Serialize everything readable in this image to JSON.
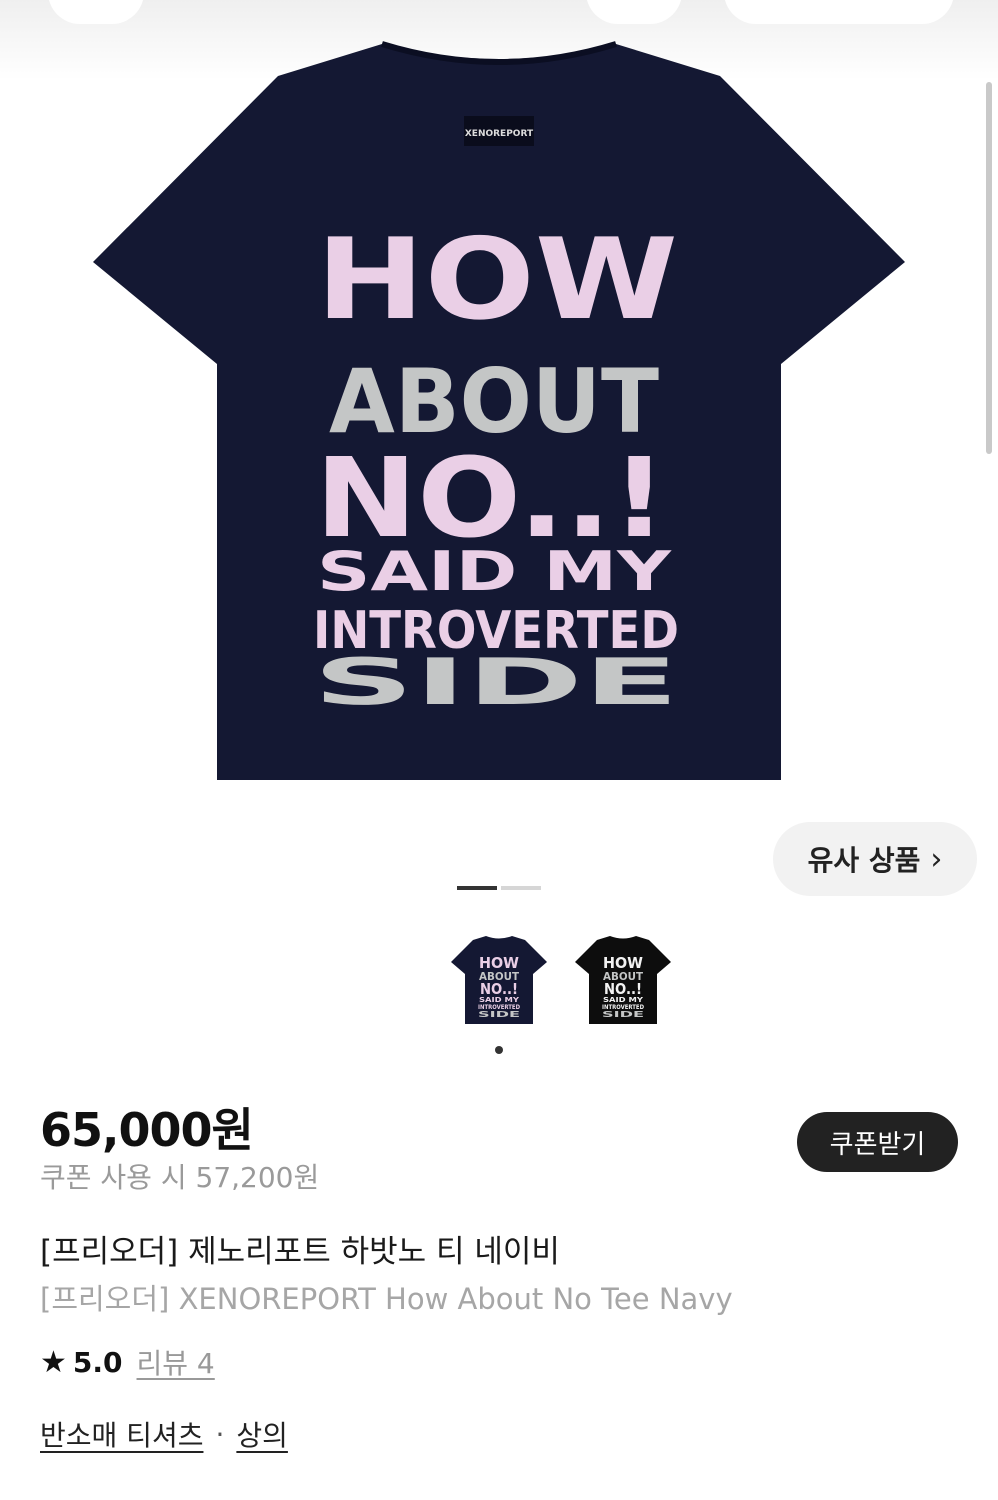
{
  "colors": {
    "shirt_navy": "#141833",
    "shirt_black": "#0d0d0d",
    "print_pink": "#eacfe6",
    "print_gray": "#c4c6c6",
    "pager_active": "#333333",
    "pager_inactive": "#d6d6d6",
    "coupon_button_bg": "#222222"
  },
  "product_image": {
    "print_lines": [
      "HOW",
      "ABOUT",
      "NO..!",
      "SAID MY",
      "INTROVERTED",
      "SIDE"
    ],
    "collar_label": "XENOREPORT",
    "current_index": 1,
    "total_images": 2
  },
  "similar_button": {
    "label": "유사 상품",
    "icon": "chevron-right-icon"
  },
  "thumbnails": [
    {
      "color": "navy",
      "selected": true
    },
    {
      "color": "black",
      "selected": false
    }
  ],
  "price": {
    "main": "65,000원",
    "coupon_text": "쿠폰 사용 시 57,200원",
    "coupon_button": "쿠폰받기"
  },
  "product": {
    "title_ko": "[프리오더] 제노리포트 하밧노 티 네이비",
    "title_en": "[프리오더] XENOREPORT How About No Tee Navy"
  },
  "rating": {
    "icon": "star-icon",
    "value": "5.0",
    "review_label": "리뷰 4"
  },
  "categories": {
    "primary": "반소매 티셔츠",
    "separator": "·",
    "secondary": "상의"
  }
}
